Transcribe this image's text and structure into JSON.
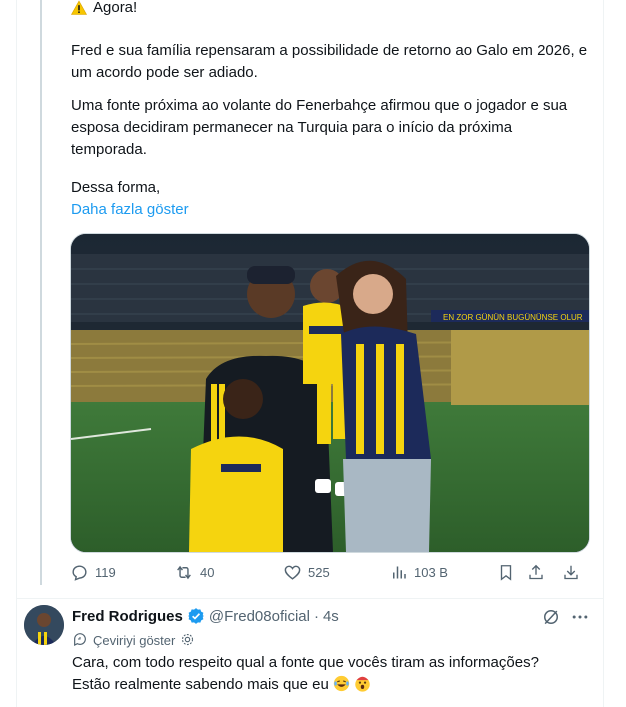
{
  "main_tweet": {
    "line1": "Agora!",
    "para2": "Fred e sua família repensaram a possibilidade de retorno ao Galo em 2026, e um acordo pode ser adiado.",
    "para3": "Uma fonte próxima ao volante do Fenerbahçe afirmou que o jogador e sua esposa decidiram permanecer na Turquia para o início da próxima temporada.",
    "para4": "Dessa forma,",
    "show_more": "Daha fazla göster",
    "media_banner_text": "EN ZOR GÜNÜN BUGÜNÜNSE OLUR"
  },
  "actions": {
    "replies": "119",
    "reposts": "40",
    "likes": "525",
    "views": "103 B"
  },
  "reply": {
    "name": "Fred Rodrigues",
    "handle": "@Fred08oficial",
    "dot": "·",
    "time": "4s",
    "translate": "Çeviriyi göster",
    "text_line1": "Cara, com todo respeito qual a fonte que vocês tiram as informações?",
    "text_line2": "Estão realmente sabendo mais que eu"
  },
  "colors": {
    "accent": "#1d9bf0",
    "muted": "#536471",
    "text": "#0f1419",
    "jersey_yellow": "#f5d40f",
    "jersey_navy": "#1c2a5a"
  }
}
